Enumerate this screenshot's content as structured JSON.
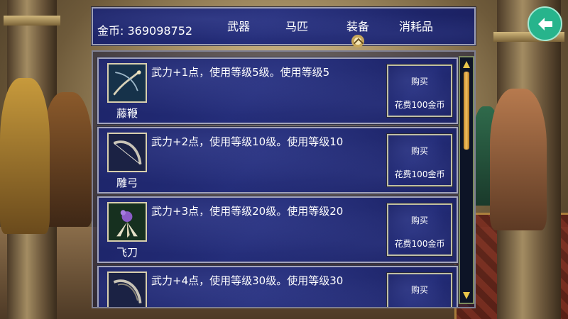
{
  "header": {
    "gold_label": "金币: 369098752",
    "tabs": [
      {
        "label": "武器",
        "active": false
      },
      {
        "label": "马匹",
        "active": false
      },
      {
        "label": "装备",
        "active": true
      },
      {
        "label": "消耗品",
        "active": false
      }
    ]
  },
  "items": [
    {
      "name": "藤鞭",
      "desc": "武力+1点，使用等级5级。使用等级5",
      "buy_label": "购买",
      "cost_label": "花费100金币",
      "icon": "whip-icon"
    },
    {
      "name": "雕弓",
      "desc": "武力+2点，使用等级10级。使用等级10",
      "buy_label": "购买",
      "cost_label": "花费100金币",
      "icon": "bow-icon"
    },
    {
      "name": "飞刀",
      "desc": "武力+3点，使用等级20级。使用等级20",
      "buy_label": "购买",
      "cost_label": "花费100金币",
      "icon": "throwing-knives-icon"
    },
    {
      "name": "",
      "desc": "武力+4点，使用等级30级。使用等级30",
      "buy_label": "购买",
      "cost_label": "",
      "icon": "bow-icon"
    }
  ],
  "colors": {
    "accent": "#27b48c",
    "panel": "#1f2670",
    "scroll_thumb": "#e0a83a"
  }
}
